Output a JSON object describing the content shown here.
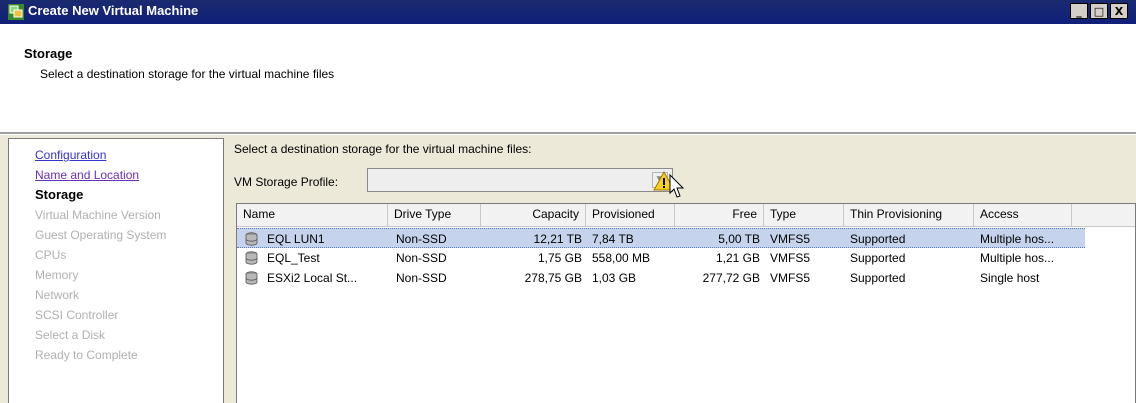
{
  "window": {
    "title": "Create New Virtual Machine",
    "controls": [
      "_",
      "□",
      "X"
    ]
  },
  "header": {
    "title": "Storage",
    "subtitle": "Select a destination storage for the virtual machine files"
  },
  "nav": {
    "items": [
      {
        "label": "Configuration",
        "state": "link"
      },
      {
        "label": "Name and Location",
        "state": "link-visited"
      },
      {
        "label": "Storage",
        "state": "current"
      },
      {
        "label": "Virtual Machine Version",
        "state": "disabled"
      },
      {
        "label": "Guest Operating System",
        "state": "disabled"
      },
      {
        "label": "CPUs",
        "state": "disabled"
      },
      {
        "label": "Memory",
        "state": "disabled"
      },
      {
        "label": "Network",
        "state": "disabled"
      },
      {
        "label": "SCSI Controller",
        "state": "disabled"
      },
      {
        "label": "Select a Disk",
        "state": "disabled"
      },
      {
        "label": "Ready to Complete",
        "state": "disabled"
      }
    ]
  },
  "content": {
    "prompt": "Select a destination storage for the virtual machine files:",
    "profile_label": "VM Storage Profile:",
    "profile_value": ""
  },
  "table": {
    "columns": [
      "Name",
      "Drive Type",
      "Capacity",
      "Provisioned",
      "Free",
      "Type",
      "Thin Provisioning",
      "Access"
    ],
    "rows": [
      {
        "name": "EQL LUN1",
        "drive_type": "Non-SSD",
        "capacity": "12,21 TB",
        "provisioned": "7,84 TB",
        "free": "5,00 TB",
        "type": "VMFS5",
        "thin": "Supported",
        "access": "Multiple hos...",
        "selected": true
      },
      {
        "name": "EQL_Test",
        "drive_type": "Non-SSD",
        "capacity": "1,75 GB",
        "provisioned": "558,00 MB",
        "free": "1,21 GB",
        "type": "VMFS5",
        "thin": "Supported",
        "access": "Multiple hos...",
        "selected": false
      },
      {
        "name": "ESXi2 Local St...",
        "drive_type": "Non-SSD",
        "capacity": "278,75 GB",
        "provisioned": "1,03 GB",
        "free": "277,72 GB",
        "type": "VMFS5",
        "thin": "Supported",
        "access": "Single host",
        "selected": false
      }
    ]
  },
  "colors": {
    "titlebar": "#10207a",
    "selection": "#c5d3ec",
    "link": "#3333cc",
    "disabled": "#b0b0b0"
  }
}
